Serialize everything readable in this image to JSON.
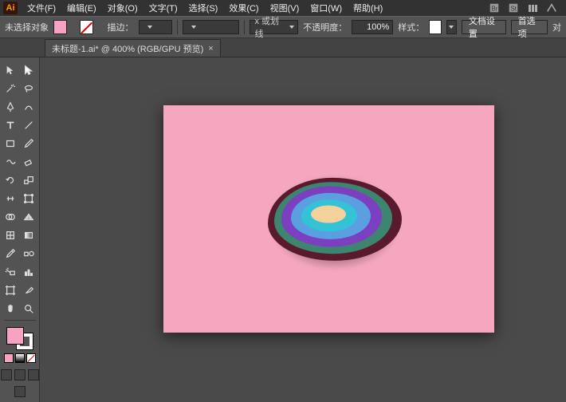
{
  "app": {
    "logo": "Ai"
  },
  "menu": {
    "file": "文件(F)",
    "edit": "编辑(E)",
    "object": "对象(O)",
    "type": "文字(T)",
    "select": "选择(S)",
    "effect": "效果(C)",
    "view": "视图(V)",
    "window": "窗口(W)",
    "help": "帮助(H)"
  },
  "opt": {
    "selection_hint": "未选择对象",
    "stroke_label": "描边：",
    "stroke_pt": "",
    "uniform": "x 或划线",
    "opacity_label": "不透明度：",
    "opacity_value": "100%",
    "style_label": "样式：",
    "doc_setup": "文档设置",
    "preferences": "首选项",
    "align": "对"
  },
  "tab": {
    "title": "未标题-1.ai* @ 400% (RGB/GPU 预览)",
    "close": "×"
  },
  "colors": {
    "fill": "#f7a2c3",
    "canvas": "#f5a7c0"
  }
}
